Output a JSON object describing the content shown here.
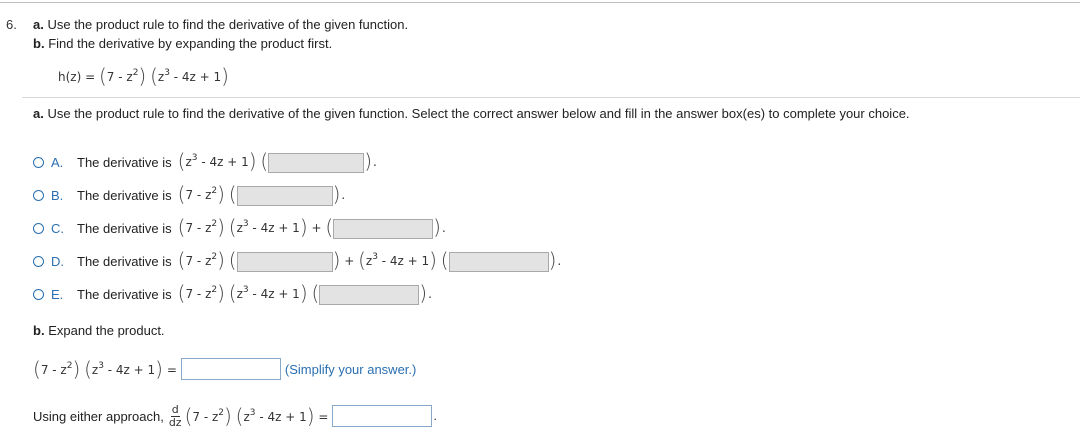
{
  "question": {
    "number": "6.",
    "part_a_label": "a.",
    "part_a_text": "Use the product rule to find the derivative of the given function.",
    "part_b_label": "b.",
    "part_b_text": "Find the derivative by expanding the product first."
  },
  "function": {
    "lhs": "h(z) =",
    "factor1": "7 - z",
    "factor2": "z",
    "factor2_rest": " - 4z + 1",
    "exponent2": "2",
    "exponent3": "3"
  },
  "part_a": {
    "label": "a.",
    "instruction": "Use the product rule to find the derivative of the given function. Select the correct answer below and fill in the answer box(es) to complete your choice."
  },
  "options": [
    {
      "label": "A.",
      "prefix": "The derivative is"
    },
    {
      "label": "B.",
      "prefix": "The derivative is"
    },
    {
      "label": "C.",
      "prefix": "The derivative is"
    },
    {
      "label": "D.",
      "prefix": "The derivative is"
    },
    {
      "label": "E.",
      "prefix": "The derivative is"
    }
  ],
  "part_b": {
    "label": "b.",
    "text": "Expand the product.",
    "equals": "=",
    "hint": "(Simplify your answer.)"
  },
  "either": {
    "text": "Using either approach,",
    "d_num": "d",
    "d_den": "dz",
    "equals": "=",
    "period": "."
  },
  "colors": {
    "accent": "#2a6fb0",
    "answer_box_fill": "#e3e3e3"
  }
}
